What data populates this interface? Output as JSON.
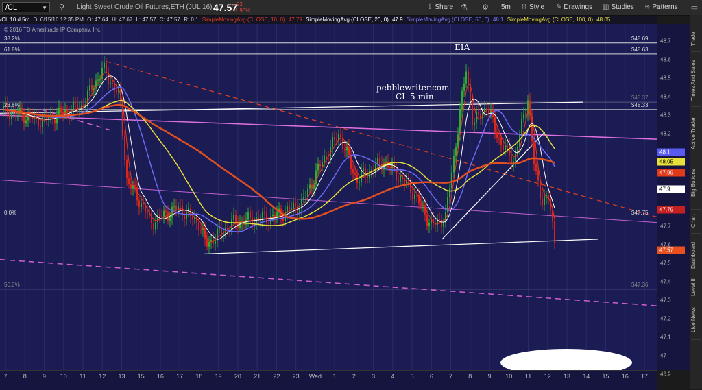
{
  "toolbar": {
    "symbol": "/CL",
    "title": "Light Sweet Crude Oil Futures,ETH (JUL 16)",
    "price": "47.57",
    "change": "-.92",
    "change_pct": "-1.90%",
    "share_label": "Share",
    "timeframe_label": "5m",
    "style_label": "Style",
    "drawings_label": "Drawings",
    "studies_label": "Studies",
    "patterns_label": "Patterns"
  },
  "infobar": {
    "symbol": "/CL 10 d 5m",
    "date": "D: 6/15/16 12:35 PM",
    "open": "O: 47.64",
    "high": "H: 47.67",
    "low": "L: 47.57",
    "close": "C: 47.57",
    "r": "R: 0.1",
    "sma10": "SimpleMovingAvg (CLOSE, 10, 0)",
    "sma10_val": "47.79",
    "sma20": "SimpleMovingAvg (CLOSE, 20, 0)",
    "sma20_val": "47.9",
    "sma50": "SimpleMovingAvg (CLOSE, 50, 0)",
    "sma50_val": "48.1",
    "sma100": "SimpleMovingAvg (CLOSE, 100, 0)",
    "sma100_val": "48.05"
  },
  "chart": {
    "copyright": "© 2016 TD Ameritrade IP Company, Inc.",
    "annotation_site": "pebblewriter.com",
    "annotation_sub": "CL 5-min",
    "annotation_eia": "EIA",
    "fib": [
      {
        "label": "38.2%",
        "price": "$48.69"
      },
      {
        "label": "61.8%",
        "price": "$48.63"
      },
      {
        "label": "23.6%",
        "price": "$48.33"
      },
      {
        "label": "0.0%",
        "price": "$47.75"
      },
      {
        "label": "50.0%",
        "price": "$47.36"
      }
    ],
    "fib_ghost_price": "$48.37"
  },
  "y_axis": {
    "ticks": [
      "48.7",
      "48.6",
      "48.5",
      "48.4",
      "48.3",
      "48.2",
      "47.9",
      "47.7",
      "47.6",
      "47.5",
      "47.4",
      "47.3",
      "47.2",
      "47.1",
      "47",
      "46.9"
    ],
    "flags": [
      {
        "label": "48.1",
        "color": "#5a5af0"
      },
      {
        "label": "48.05",
        "color": "#e8e03a"
      },
      {
        "label": "47.99",
        "color": "#e03a1a"
      },
      {
        "label": "47.9",
        "color": "#ffffff"
      },
      {
        "label": "47.79",
        "color": "#c42020"
      },
      {
        "label": "47.57",
        "color": "#e85020"
      }
    ]
  },
  "x_axis": {
    "ticks": [
      "7",
      "8",
      "9",
      "10",
      "11",
      "12",
      "13",
      "15",
      "16",
      "17",
      "18",
      "19",
      "20",
      "21",
      "22",
      "23",
      "Wed",
      "1",
      "2",
      "3",
      "4",
      "5",
      "6",
      "7",
      "8",
      "9",
      "10",
      "11",
      "12",
      "13",
      "14",
      "15",
      "16",
      "17"
    ]
  },
  "right_tabs": [
    "Trade",
    "Times And Sales",
    "Active Trader",
    "Big Buttons",
    "Chart",
    "Dashboard",
    "Level II",
    "Live News"
  ],
  "colors": {
    "chart_bg": "#1c1c55",
    "up_bar": "#2fae2f",
    "down_bar": "#d9261c",
    "sma10": "#e03a1a",
    "sma20": "#ffffff",
    "sma50": "#6a6af5",
    "sma100": "#e8e03a"
  }
}
